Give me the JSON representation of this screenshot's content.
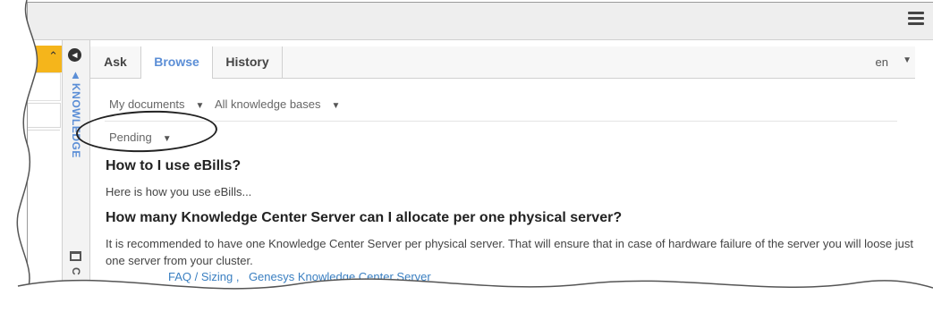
{
  "tabs": [
    {
      "label": "Ask"
    },
    {
      "label": "Browse"
    },
    {
      "label": "History"
    }
  ],
  "language": {
    "value": "en"
  },
  "sidebar": {
    "title": "KNOWLEDGE",
    "second_title": "C"
  },
  "filters": {
    "documents": "My documents",
    "knowledge_bases": "All knowledge bases",
    "status": "Pending"
  },
  "articles": [
    {
      "title": "How to I use eBills?",
      "body": "Here is how you use eBills..."
    },
    {
      "title": "How many Knowledge Center Server can I allocate per one physical server?",
      "body": "It is recommended to have one Knowledge Center Server per physical server. That will ensure that in case of hardware failure of the server you will loose just one server from your cluster.",
      "tags": [
        "FAQ / Sizing ,",
        "Genesys Knowledge Center Server"
      ]
    }
  ],
  "colors": {
    "accent": "#5b8ed6",
    "orange": "#f5b51b",
    "link": "#3a7fc1"
  }
}
